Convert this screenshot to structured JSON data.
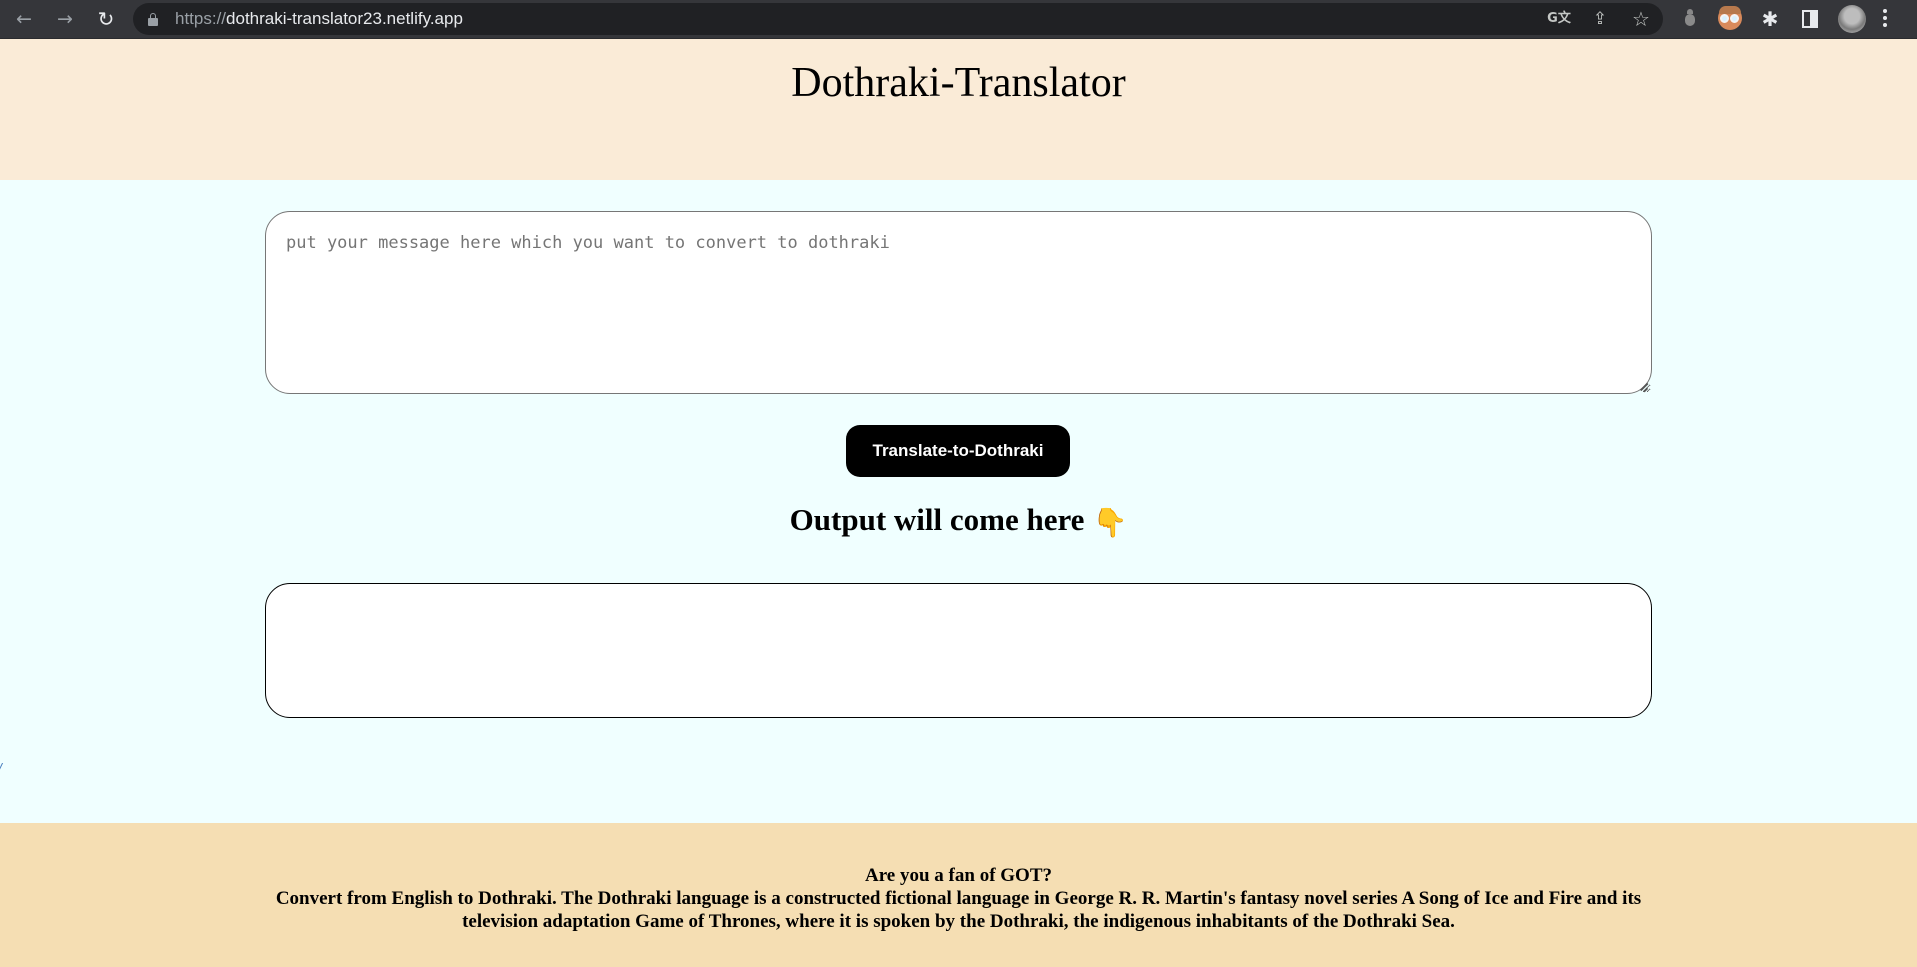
{
  "browser": {
    "url_scheme": "https://",
    "url_host": "dothraki-translator23.netlify.app",
    "icons": {
      "back": "←",
      "forward": "→",
      "reload": "↻",
      "translate": "G文",
      "share": "⇪",
      "bookmark": "☆",
      "extensions": "✱"
    }
  },
  "header": {
    "title": "Dothraki-Translator"
  },
  "main": {
    "input_placeholder": "put your message here which you want to convert to dothraki",
    "input_value": "",
    "translate_button": "Translate-to-Dothraki",
    "output_heading": "Output will come here",
    "output_icon": "👇",
    "output_text": "",
    "stray_text": "/"
  },
  "footer": {
    "question": "Are you a fan of GOT?",
    "description": "Convert from English to Dothraki. The Dothraki language is a constructed fictional language in George R. R. Martin's fantasy novel series A Song of Ice and Fire and its television adaptation Game of Thrones, where it is spoken by the Dothraki, the indigenous inhabitants of the Dothraki Sea."
  },
  "colors": {
    "header_bg": "#faebd7",
    "main_bg": "#f0ffff",
    "footer_bg": "#f5deb3",
    "button_bg": "#000000",
    "button_text": "#ffffff"
  }
}
